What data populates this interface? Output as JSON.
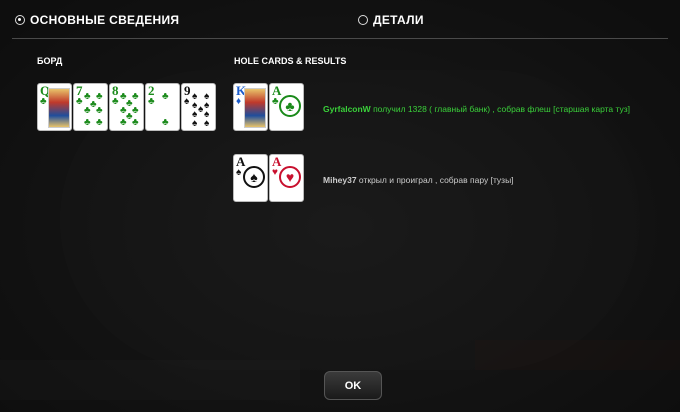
{
  "tabs": [
    {
      "label": "ОСНОВНЫЕ СВЕДЕНИЯ",
      "selected": true
    },
    {
      "label": "ДЕТАЛИ",
      "selected": false
    }
  ],
  "board": {
    "title": "БОРД",
    "cards": [
      {
        "rank": "Q",
        "suit": "♣"
      },
      {
        "rank": "7",
        "suit": "♣"
      },
      {
        "rank": "8",
        "suit": "♣"
      },
      {
        "rank": "2",
        "suit": "♣"
      },
      {
        "rank": "9",
        "suit": "♠"
      }
    ]
  },
  "results": {
    "title": "HOLE CARDS & RESULTS",
    "players": [
      {
        "cards": [
          {
            "rank": "K",
            "suit": "♦"
          },
          {
            "rank": "A",
            "suit": "♣"
          }
        ],
        "name": "GyrfalconW",
        "text": " получил 1328 ( главный банк) , собрав флеш [старшая карта туз]",
        "winner": true
      },
      {
        "cards": [
          {
            "rank": "A",
            "suit": "♠"
          },
          {
            "rank": "A",
            "suit": "♥"
          }
        ],
        "name": "Mihey37",
        "text": " открыл и проиграл , собрав пару [тузы]",
        "winner": false
      }
    ]
  },
  "ok_button": "OK",
  "colors": {
    "winner": "#3ad13a",
    "club": "#1a8a1a",
    "diamond": "#1a5ccc",
    "heart": "#c8102e",
    "spade": "#111111"
  }
}
